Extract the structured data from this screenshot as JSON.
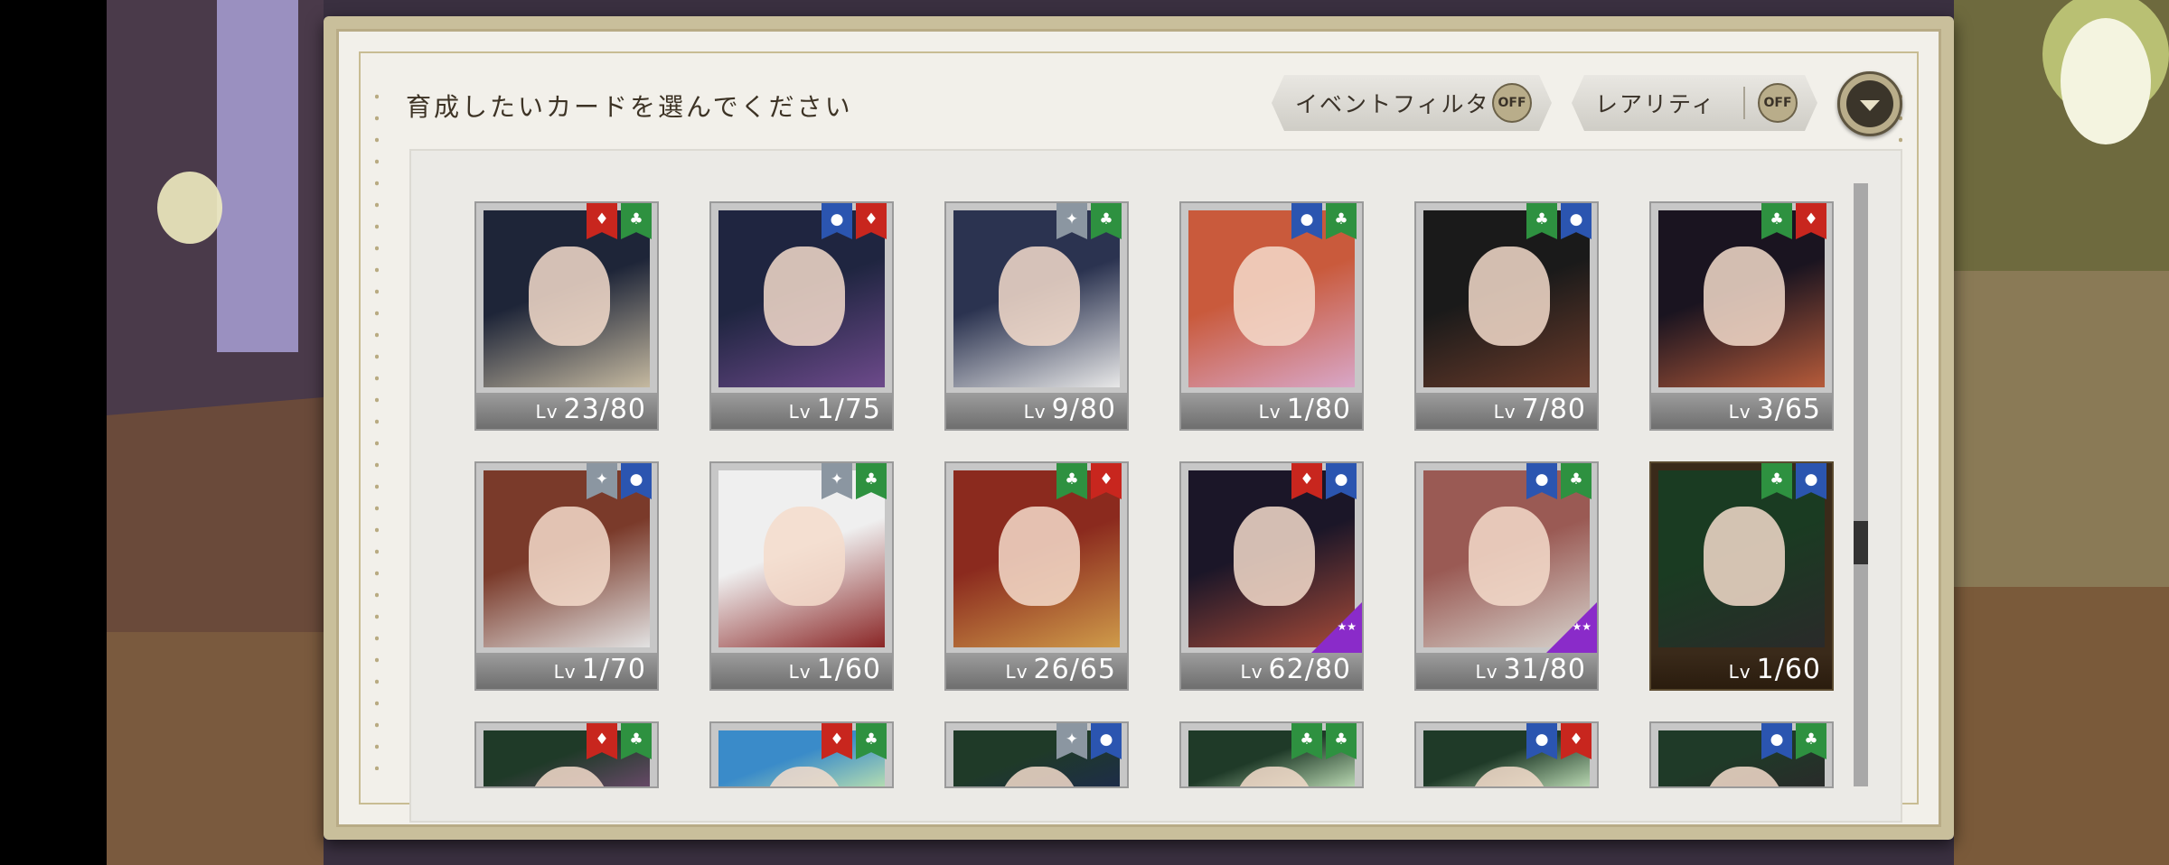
{
  "header": {
    "title": "育成したいカードを選んでください",
    "event_filter": {
      "label": "イベントフィルタ",
      "state": "OFF"
    },
    "rarity_filter": {
      "label": "レアリティ",
      "state": "OFF"
    }
  },
  "cards": [
    {
      "level": "23/80",
      "tags": [
        "red",
        "green"
      ],
      "colors": [
        "#1e2538",
        "#c5b9a0"
      ],
      "special": false,
      "stars": false
    },
    {
      "level": "1/75",
      "tags": [
        "blue",
        "red"
      ],
      "colors": [
        "#1f2540",
        "#6d4a8b"
      ],
      "special": false,
      "stars": false
    },
    {
      "level": "9/80",
      "tags": [
        "gray",
        "green"
      ],
      "colors": [
        "#2b3350",
        "#e8e8e8"
      ],
      "special": false,
      "stars": false
    },
    {
      "level": "1/80",
      "tags": [
        "blue",
        "green"
      ],
      "colors": [
        "#c95a3c",
        "#d8a7c8"
      ],
      "special": false,
      "stars": false
    },
    {
      "level": "7/80",
      "tags": [
        "green",
        "blue"
      ],
      "colors": [
        "#1a1a1a",
        "#6b3b2a"
      ],
      "special": false,
      "stars": false
    },
    {
      "level": "3/65",
      "tags": [
        "green",
        "red"
      ],
      "colors": [
        "#1a1420",
        "#b65b3a"
      ],
      "special": false,
      "stars": false
    },
    {
      "level": "1/70",
      "tags": [
        "gray",
        "blue"
      ],
      "colors": [
        "#7a3a2a",
        "#e2e2e2"
      ],
      "special": false,
      "stars": false
    },
    {
      "level": "1/60",
      "tags": [
        "gray",
        "green"
      ],
      "colors": [
        "#efefef",
        "#8a2626"
      ],
      "special": false,
      "stars": false
    },
    {
      "level": "26/65",
      "tags": [
        "green",
        "red"
      ],
      "colors": [
        "#8b2a1e",
        "#cf9b4a"
      ],
      "special": false,
      "stars": false
    },
    {
      "level": "62/80",
      "tags": [
        "red",
        "blue"
      ],
      "colors": [
        "#1b1628",
        "#a54a38"
      ],
      "special": false,
      "stars": true
    },
    {
      "level": "31/80",
      "tags": [
        "blue",
        "green"
      ],
      "colors": [
        "#9a5a54",
        "#d6d2cc"
      ],
      "special": false,
      "stars": true
    },
    {
      "level": "1/60",
      "tags": [
        "green",
        "blue"
      ],
      "colors": [
        "#1a3b22",
        "#2a2a2a"
      ],
      "special": true,
      "stars": false
    },
    {
      "level": "",
      "tags": [
        "red",
        "green"
      ],
      "colors": [
        "#1f3a28",
        "#6a4a6a"
      ],
      "special": false,
      "stars": false
    },
    {
      "level": "",
      "tags": [
        "red",
        "green"
      ],
      "colors": [
        "#3a8bc9",
        "#b9e0b0"
      ],
      "special": false,
      "stars": false
    },
    {
      "level": "",
      "tags": [
        "gray",
        "blue"
      ],
      "colors": [
        "#1f3a28",
        "#1e2c4a"
      ],
      "special": false,
      "stars": false
    },
    {
      "level": "",
      "tags": [
        "green",
        "green"
      ],
      "colors": [
        "#1f3a28",
        "#c0dfb8"
      ],
      "special": false,
      "stars": false
    },
    {
      "level": "",
      "tags": [
        "blue",
        "red"
      ],
      "colors": [
        "#1f3a28",
        "#c0dfb8"
      ],
      "special": false,
      "stars": false
    },
    {
      "level": "",
      "tags": [
        "blue",
        "green"
      ],
      "colors": [
        "#1f3a28",
        "#2a2a2a"
      ],
      "special": false,
      "stars": false
    }
  ],
  "lv_prefix": "Lv",
  "tag_icons": {
    "red": "flame-icon",
    "green": "leaf-icon",
    "blue": "water-drop-icon",
    "gray": "star-icon"
  },
  "colors": {
    "panel_border": "#c9bf9b",
    "panel_bg": "#f2f0ea",
    "accent_dark": "#3b352a"
  }
}
